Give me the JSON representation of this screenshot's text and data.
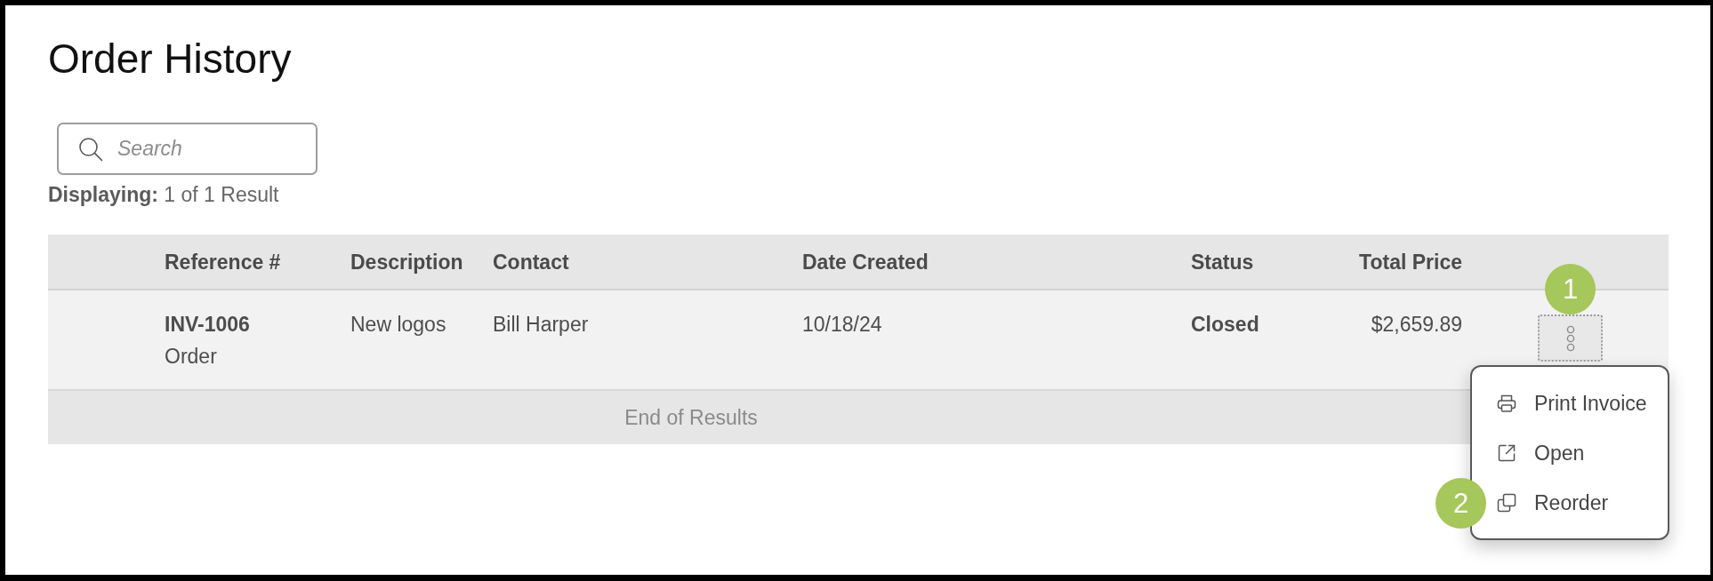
{
  "page": {
    "title": "Order History"
  },
  "search": {
    "placeholder": "Search"
  },
  "result_summary": "**Displaying:** 1 of 1 Result",
  "table": {
    "columns": [
      "Reference #",
      "Description",
      "Contact",
      "Date Created",
      "Status",
      "Total Price"
    ],
    "rows": [
      {
        "reference": "INV-1006",
        "record_type": "Order",
        "description": "New logos",
        "contact": "Bill Harper",
        "date_created": "10/18/24",
        "status": "Closed",
        "total_price": "$2,659.89",
        "menu": {
          "open": true,
          "button_callout": "1",
          "items": [
            {
              "label": "Print Invoice",
              "kind": "print"
            },
            {
              "label": "Open",
              "kind": "open"
            },
            {
              "label": "Reorder",
              "kind": "reorder",
              "callout": "2"
            }
          ]
        }
      }
    ],
    "footer": "End of Results"
  }
}
